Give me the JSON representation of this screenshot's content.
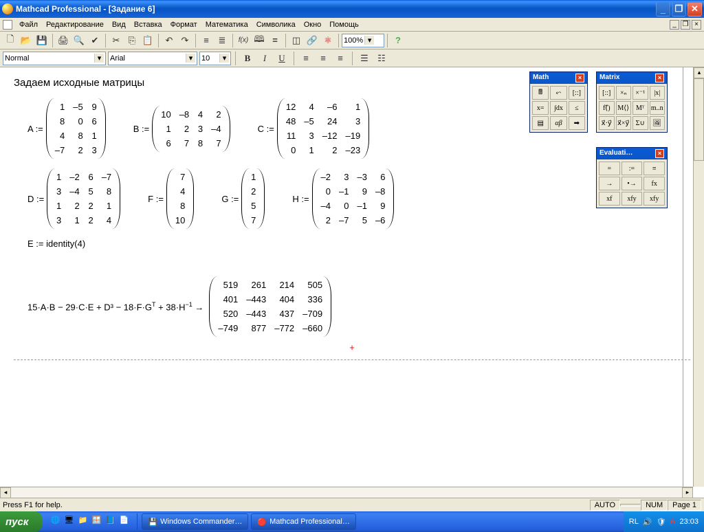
{
  "title": "Mathcad Professional - [Задание 6]",
  "menu": [
    "Файл",
    "Редактирование",
    "Вид",
    "Вставка",
    "Формат",
    "Математика",
    "Символика",
    "Окно",
    "Помощь"
  ],
  "zoom": "100%",
  "format": {
    "style": "Normal",
    "font": "Arial",
    "size": "10"
  },
  "doc": {
    "heading": "Задаем исходные матрицы",
    "A": [
      [
        1,
        -5,
        9
      ],
      [
        8,
        0,
        6
      ],
      [
        4,
        8,
        1
      ],
      [
        -7,
        2,
        3
      ]
    ],
    "B": [
      [
        10,
        -8,
        4,
        2
      ],
      [
        1,
        2,
        3,
        -4
      ],
      [
        6,
        7,
        8,
        7
      ]
    ],
    "C": [
      [
        12,
        4,
        -6,
        1
      ],
      [
        48,
        -5,
        24,
        3
      ],
      [
        11,
        3,
        -12,
        -19
      ],
      [
        0,
        1,
        2,
        -23
      ]
    ],
    "D": [
      [
        1,
        -2,
        6,
        -7
      ],
      [
        3,
        -4,
        5,
        8
      ],
      [
        1,
        2,
        2,
        1
      ],
      [
        3,
        1,
        2,
        4
      ]
    ],
    "F": [
      [
        7
      ],
      [
        4
      ],
      [
        8
      ],
      [
        10
      ]
    ],
    "G": [
      [
        1
      ],
      [
        2
      ],
      [
        5
      ],
      [
        7
      ]
    ],
    "H": [
      [
        -2,
        3,
        -3,
        6
      ],
      [
        0,
        -1,
        9,
        -8
      ],
      [
        -4,
        0,
        -1,
        9
      ],
      [
        2,
        -7,
        5,
        -6
      ]
    ],
    "E_expr": "E := identity(4)",
    "result_lhs": "15·A·B − 29·C·E + D³ − 18·F·G",
    "result_sup1": "T",
    "result_mid": " + 38·H",
    "result_sup2": "−1",
    "result_arrow": " →",
    "R": [
      [
        519,
        261,
        214,
        505
      ],
      [
        401,
        -443,
        404,
        336
      ],
      [
        520,
        -443,
        437,
        -709
      ],
      [
        -749,
        877,
        -772,
        -660
      ]
    ]
  },
  "palettes": {
    "math": "Math",
    "matrix": "Matrix",
    "eval": "Evaluati…"
  },
  "status": {
    "help": "Press F1 for help.",
    "auto": "AUTO",
    "num": "NUM",
    "page": "Page 1"
  },
  "taskbar": {
    "start": "пуск",
    "task1": "Windows Commander…",
    "task2": "Mathcad Professional…",
    "lang": "RL",
    "time": "23:03"
  }
}
